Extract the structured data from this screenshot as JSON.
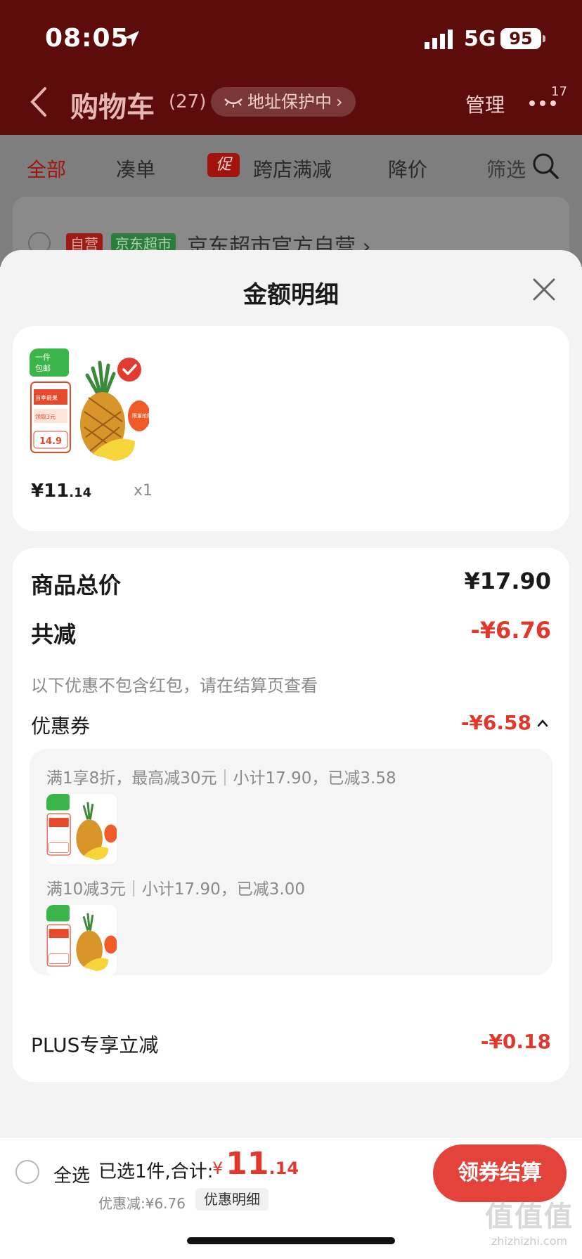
{
  "status_bar": {
    "time": "08:05",
    "network": "5G",
    "battery": "95"
  },
  "nav": {
    "title": "购物车",
    "count": "(27)",
    "address_protection": "地址保护中",
    "address_chevron": "›",
    "manage": "管理",
    "more_badge": "17"
  },
  "filters": {
    "all": "全部",
    "cou": "凑单",
    "promo_tag": "促",
    "kuadian": "跨店满减",
    "jiangjia": "降价",
    "shaixuan": "筛选"
  },
  "shop": {
    "tag_self": "自营",
    "tag_market": "京东超市",
    "name": "京东超市官方自营 ›"
  },
  "sheet": {
    "title": "金额明细",
    "item": {
      "price_int": "¥11",
      "price_dec": ".14",
      "qty": "x1"
    },
    "product_thumb_text": {
      "badge_line1": "一件",
      "badge_line2": "包邮",
      "banner": "当季最果",
      "coupon": "领取3元",
      "price": "14.9",
      "hot": "限量抢购"
    },
    "goods_total_label": "商品总价",
    "goods_total_value": "¥17.90",
    "total_reduce_label": "共减",
    "total_reduce_value": "-¥6.76",
    "note": "以下优惠不包含红包，请在结算页查看",
    "coupon_label": "优惠券",
    "coupon_value": "-¥6.58",
    "coupon_lines": [
      "满1享8折，最高减30元｜小计17.90，已减3.58",
      "满10减3元｜小计17.90，已减3.00"
    ],
    "plus_label": "PLUS专享立减",
    "plus_value": "-¥0.18"
  },
  "bottom": {
    "select_all": "全选",
    "selected_text": "已选1件,合计:",
    "total_yen": "¥",
    "total_int": "11",
    "total_dec": ".14",
    "discount_text": "优惠减:¥6.76",
    "detail_chip": "优惠明细",
    "checkout": "领券结算"
  },
  "watermark": {
    "big": "值值值",
    "small": "zhizhizhi.com"
  },
  "colors": {
    "accent": "#e2382c",
    "header": "#5c0c0a",
    "checkout": "#e3433a"
  }
}
